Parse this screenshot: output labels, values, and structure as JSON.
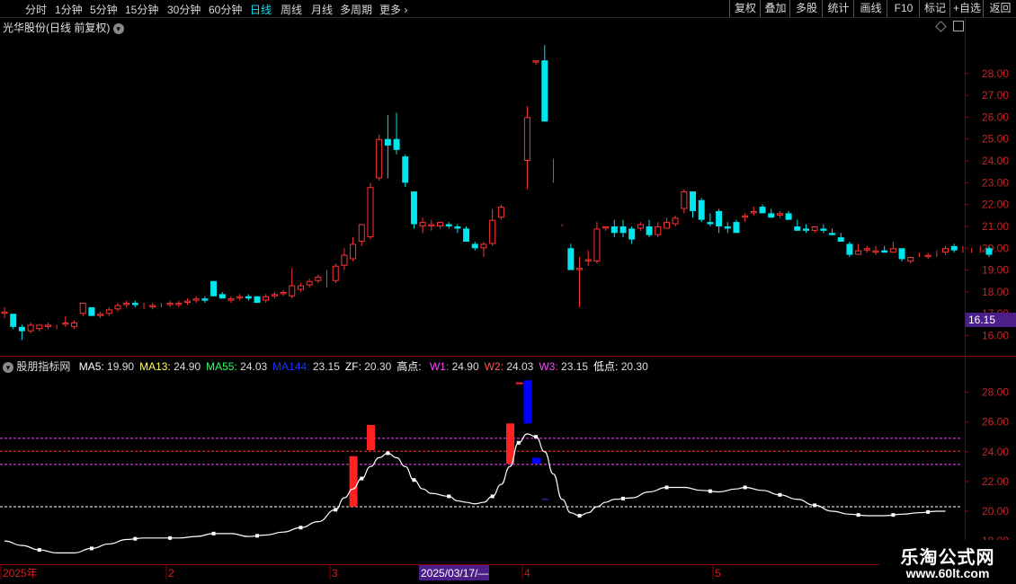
{
  "toolbar": {
    "periods": [
      "分时",
      "1分钟",
      "5分钟",
      "15分钟",
      "30分钟",
      "60分钟",
      "日线",
      "周线",
      "月线",
      "多周期",
      "更多"
    ],
    "active_period": "日线",
    "more_arrow": "›",
    "right_buttons": [
      "复权",
      "叠加",
      "多股",
      "统计",
      "画线",
      "F10",
      "标记",
      "+自选",
      "返回"
    ]
  },
  "stock": {
    "title": "光华股份(日线 前复权)",
    "dropdown_icon": "chevron-down-icon",
    "diamond_icon": "diamond-icon",
    "panel_icon": "window-icon"
  },
  "main_axis": {
    "ticks": [
      "28.00",
      "27.00",
      "26.00",
      "25.00",
      "24.00",
      "23.00",
      "22.00",
      "21.00",
      "20.00",
      "19.00",
      "18.00",
      "17.00",
      "16.00"
    ],
    "price_tag": "16.15",
    "ymin": 15.2,
    "ymax": 29.8
  },
  "indicator": {
    "name": "股朋指标网",
    "items": [
      {
        "label": "MA5: ",
        "value": "19.90",
        "color": "#ffffff"
      },
      {
        "label": "MA13: ",
        "value": "24.90",
        "color": "#ffff55"
      },
      {
        "label": "MA55: ",
        "value": "24.03",
        "color": "#33ff66"
      },
      {
        "label": "MA144: ",
        "value": "23.15",
        "color": "#2233ff"
      },
      {
        "label": "ZF: ",
        "value": "20.30",
        "color": "#ffffff"
      },
      {
        "label": "高点: ",
        "value": "",
        "color": "#ffffff"
      },
      {
        "label": "W1: ",
        "value": "24.90",
        "color": "#ff44ff"
      },
      {
        "label": "W2: ",
        "value": "24.03",
        "color": "#ff5555"
      },
      {
        "label": "W3: ",
        "value": "23.15",
        "color": "#ff44ff"
      },
      {
        "label": "低点: ",
        "value": "20.30",
        "color": "#ffffff"
      }
    ],
    "ticks": [
      "28.00",
      "26.00",
      "24.00",
      "22.00",
      "20.00",
      "18.00"
    ],
    "ymin": 16.8,
    "ymax": 29.3,
    "levels": [
      {
        "value": 24.9,
        "color": "#ff44ff"
      },
      {
        "value": 24.03,
        "color": "#ff3333"
      },
      {
        "value": 23.15,
        "color": "#ff44ff"
      },
      {
        "value": 20.3,
        "color": "#ffffff"
      }
    ]
  },
  "x_axis": {
    "labels": [
      "2025年",
      "2",
      "3",
      "2025/03/17/—",
      "4",
      "5"
    ],
    "highlight": "2025/03/17/—"
  },
  "watermark": {
    "line1": "乐淘公式网",
    "line2": "www.60lt.com"
  },
  "colors": {
    "up": "#ff3333",
    "down": "#00e5ee",
    "axis": "#8b0000",
    "grid": "#5a0000"
  },
  "chart_data": {
    "type": "candlestick",
    "candles": [
      [
        17.0,
        17.3,
        16.8,
        17.1
      ],
      [
        17.0,
        17.0,
        16.3,
        16.4
      ],
      [
        16.4,
        16.5,
        15.8,
        16.2
      ],
      [
        16.2,
        16.6,
        16.1,
        16.5
      ],
      [
        16.3,
        16.5,
        16.2,
        16.5
      ],
      [
        16.4,
        16.6,
        16.3,
        16.5
      ],
      [
        16.4,
        16.5,
        16.3,
        16.4
      ],
      [
        16.5,
        16.9,
        16.4,
        16.6
      ],
      [
        16.4,
        16.7,
        16.3,
        16.6
      ],
      [
        17.0,
        17.4,
        16.9,
        17.5
      ],
      [
        17.3,
        17.3,
        16.9,
        16.9
      ],
      [
        16.9,
        17.1,
        16.8,
        17.0
      ],
      [
        17.0,
        17.3,
        16.9,
        17.2
      ],
      [
        17.2,
        17.5,
        17.1,
        17.4
      ],
      [
        17.4,
        17.6,
        17.3,
        17.5
      ],
      [
        17.5,
        17.6,
        17.3,
        17.4
      ],
      [
        17.3,
        17.5,
        17.2,
        17.3
      ],
      [
        17.3,
        17.5,
        17.2,
        17.4
      ],
      [
        17.4,
        17.5,
        17.3,
        17.4
      ],
      [
        17.4,
        17.6,
        17.3,
        17.5
      ],
      [
        17.4,
        17.6,
        17.3,
        17.5
      ],
      [
        17.5,
        17.7,
        17.4,
        17.6
      ],
      [
        17.6,
        17.8,
        17.5,
        17.7
      ],
      [
        17.7,
        17.8,
        17.5,
        17.6
      ],
      [
        18.5,
        18.5,
        17.8,
        17.8
      ],
      [
        17.9,
        18.0,
        17.7,
        17.7
      ],
      [
        17.6,
        17.8,
        17.5,
        17.7
      ],
      [
        17.7,
        17.9,
        17.6,
        17.8
      ],
      [
        17.8,
        17.9,
        17.6,
        17.7
      ],
      [
        17.8,
        17.8,
        17.5,
        17.5
      ],
      [
        17.6,
        17.9,
        17.5,
        17.8
      ],
      [
        17.8,
        18.0,
        17.7,
        17.9
      ],
      [
        17.9,
        18.1,
        17.8,
        18.0
      ],
      [
        17.8,
        19.1,
        17.7,
        18.3
      ],
      [
        18.1,
        18.4,
        18.0,
        18.3
      ],
      [
        18.3,
        18.6,
        18.2,
        18.5
      ],
      [
        18.5,
        18.8,
        18.4,
        18.7
      ],
      [
        18.7,
        19.0,
        18.2,
        18.7
      ],
      [
        18.5,
        19.3,
        18.4,
        19.2
      ],
      [
        19.2,
        20.0,
        19.0,
        19.7
      ],
      [
        19.5,
        20.5,
        19.4,
        20.2
      ],
      [
        20.3,
        21.1,
        20.1,
        21.1
      ],
      [
        20.5,
        23.0,
        20.4,
        22.8
      ],
      [
        23.2,
        25.2,
        23.1,
        25.0
      ],
      [
        25.0,
        26.1,
        23.2,
        24.7
      ],
      [
        25.0,
        26.2,
        24.3,
        24.5
      ],
      [
        24.2,
        24.3,
        22.8,
        23.0
      ],
      [
        22.6,
        22.6,
        20.9,
        21.1
      ],
      [
        21.0,
        21.4,
        20.7,
        21.2
      ],
      [
        21.0,
        21.3,
        20.8,
        21.1
      ],
      [
        21.0,
        21.2,
        20.9,
        21.2
      ],
      [
        21.1,
        21.2,
        20.9,
        21.0
      ],
      [
        21.0,
        21.1,
        20.7,
        20.9
      ],
      [
        20.9,
        21.0,
        20.5,
        20.3
      ],
      [
        20.2,
        20.3,
        19.9,
        20.0
      ],
      [
        20.0,
        20.3,
        19.6,
        20.2
      ],
      [
        20.2,
        21.8,
        20.1,
        21.3
      ],
      [
        21.4,
        22.0,
        21.3,
        21.9
      ],
      [
        21.6,
        21.6,
        21.6,
        21.6
      ],
      [
        23.6,
        23.6,
        23.6,
        23.6
      ],
      [
        24.0,
        26.5,
        22.7,
        26.0
      ],
      [
        28.5,
        28.6,
        28.4,
        28.6
      ],
      [
        28.6,
        29.3,
        25.8,
        25.8
      ],
      [
        23.5,
        24.1,
        23.0,
        23.5
      ],
      [
        21.0,
        21.1,
        21.0,
        21.0
      ],
      [
        20.0,
        20.2,
        19.1,
        19.0
      ],
      [
        19.0,
        19.6,
        17.3,
        19.1
      ],
      [
        19.4,
        19.9,
        19.2,
        19.5
      ],
      [
        19.4,
        21.2,
        19.3,
        20.9
      ],
      [
        20.9,
        21.0,
        20.8,
        21.0
      ],
      [
        21.0,
        21.3,
        20.5,
        20.7
      ],
      [
        21.0,
        21.3,
        20.5,
        20.7
      ],
      [
        20.9,
        21.0,
        20.2,
        20.4
      ],
      [
        20.9,
        21.2,
        20.8,
        21.1
      ],
      [
        21.0,
        21.3,
        20.5,
        20.6
      ],
      [
        20.6,
        21.2,
        20.5,
        21.0
      ],
      [
        20.9,
        21.4,
        20.9,
        21.2
      ],
      [
        21.1,
        21.5,
        21.0,
        21.4
      ],
      [
        21.8,
        22.7,
        21.6,
        22.6
      ],
      [
        22.6,
        22.6,
        21.4,
        21.7
      ],
      [
        22.2,
        22.3,
        21.2,
        21.3
      ],
      [
        21.2,
        21.6,
        21.0,
        21.1
      ],
      [
        21.7,
        21.8,
        20.7,
        21.0
      ],
      [
        21.0,
        21.2,
        20.7,
        20.9
      ],
      [
        21.2,
        21.3,
        20.8,
        20.7
      ],
      [
        21.4,
        21.6,
        21.2,
        21.5
      ],
      [
        21.6,
        21.9,
        21.5,
        21.7
      ],
      [
        21.9,
        22.0,
        21.6,
        21.6
      ],
      [
        21.6,
        21.8,
        21.4,
        21.4
      ],
      [
        21.5,
        21.7,
        21.4,
        21.6
      ],
      [
        21.6,
        21.7,
        21.3,
        21.3
      ],
      [
        21.0,
        21.3,
        20.8,
        20.8
      ],
      [
        20.9,
        21.1,
        20.7,
        20.8
      ],
      [
        20.8,
        21.0,
        20.7,
        21.0
      ],
      [
        20.9,
        21.1,
        20.7,
        20.8
      ],
      [
        20.7,
        20.9,
        20.6,
        20.6
      ],
      [
        20.5,
        20.7,
        20.3,
        20.3
      ],
      [
        20.2,
        20.3,
        19.6,
        19.7
      ],
      [
        19.7,
        20.2,
        19.7,
        19.9
      ],
      [
        19.9,
        20.1,
        19.8,
        20.0
      ],
      [
        19.8,
        20.1,
        19.7,
        19.9
      ],
      [
        19.9,
        20.1,
        19.8,
        19.8
      ],
      [
        19.8,
        20.3,
        19.8,
        20.0
      ],
      [
        20.0,
        20.0,
        19.4,
        19.5
      ],
      [
        19.4,
        19.6,
        19.3,
        19.6
      ],
      [
        19.7,
        19.8,
        19.6,
        19.7
      ],
      [
        19.6,
        19.8,
        19.5,
        19.7
      ],
      [
        19.8,
        19.9,
        19.6,
        19.8
      ],
      [
        19.8,
        20.1,
        19.7,
        20.0
      ],
      [
        20.1,
        20.2,
        19.8,
        19.9
      ],
      [
        19.9,
        20.1,
        19.8,
        19.9
      ],
      [
        19.9,
        20.0,
        19.8,
        19.9
      ],
      [
        19.9,
        20.1,
        19.8,
        19.9
      ],
      [
        20.0,
        20.1,
        19.6,
        19.7
      ]
    ],
    "line_curve": [
      [
        0,
        18.0
      ],
      [
        2,
        17.7
      ],
      [
        4,
        17.4
      ],
      [
        6,
        17.2
      ],
      [
        8,
        17.2
      ],
      [
        10,
        17.5
      ],
      [
        12,
        17.8
      ],
      [
        14,
        18.1
      ],
      [
        16,
        18.2
      ],
      [
        18,
        18.2
      ],
      [
        20,
        18.2
      ],
      [
        22,
        18.3
      ],
      [
        24,
        18.5
      ],
      [
        26,
        18.5
      ],
      [
        28,
        18.3
      ],
      [
        30,
        18.4
      ],
      [
        32,
        18.6
      ],
      [
        34,
        18.9
      ],
      [
        36,
        19.3
      ],
      [
        38,
        20.1
      ],
      [
        39,
        20.9
      ],
      [
        40,
        21.5
      ],
      [
        41,
        22.2
      ],
      [
        42,
        23.0
      ],
      [
        43,
        23.6
      ],
      [
        44,
        23.9
      ],
      [
        45,
        23.6
      ],
      [
        46,
        23.0
      ],
      [
        47,
        22.1
      ],
      [
        48,
        21.5
      ],
      [
        49,
        21.2
      ],
      [
        51,
        21.0
      ],
      [
        52,
        20.7
      ],
      [
        53,
        20.6
      ],
      [
        54,
        20.5
      ],
      [
        55,
        20.6
      ],
      [
        56,
        21.0
      ],
      [
        57,
        21.8
      ],
      [
        58,
        23.0
      ],
      [
        59,
        24.6
      ],
      [
        60,
        25.2
      ],
      [
        61,
        25.0
      ],
      [
        62,
        24.0
      ],
      [
        63,
        22.5
      ],
      [
        64,
        20.8
      ],
      [
        65,
        19.9
      ],
      [
        66,
        19.7
      ],
      [
        67,
        19.9
      ],
      [
        68,
        20.3
      ],
      [
        69,
        20.6
      ],
      [
        70,
        20.8
      ],
      [
        72,
        20.9
      ],
      [
        74,
        21.3
      ],
      [
        76,
        21.6
      ],
      [
        78,
        21.6
      ],
      [
        80,
        21.4
      ],
      [
        82,
        21.3
      ],
      [
        84,
        21.5
      ],
      [
        85,
        21.6
      ],
      [
        87,
        21.4
      ],
      [
        89,
        21.1
      ],
      [
        91,
        20.8
      ],
      [
        93,
        20.4
      ],
      [
        95,
        20.0
      ],
      [
        97,
        19.8
      ],
      [
        99,
        19.7
      ],
      [
        101,
        19.7
      ],
      [
        103,
        19.8
      ],
      [
        105,
        19.9
      ],
      [
        107,
        20.0
      ],
      [
        108,
        20.0
      ]
    ],
    "line_markers": [
      4,
      10,
      15,
      19,
      24,
      29,
      34,
      38,
      41,
      44,
      47,
      51,
      56,
      59,
      61,
      66,
      71,
      76,
      81,
      85,
      89,
      93,
      98,
      102,
      106
    ],
    "bars": [
      {
        "i": 40,
        "lo": 20.3,
        "hi": 23.7,
        "color": "#ff2222"
      },
      {
        "i": 42,
        "lo": 24.1,
        "hi": 25.8,
        "color": "#ff2222"
      },
      {
        "i": 58,
        "lo": 23.2,
        "hi": 25.9,
        "color": "#ff2222"
      },
      {
        "i": 60,
        "lo": 25.9,
        "hi": 28.8,
        "color": "#0000ff"
      },
      {
        "i": 61,
        "lo": 23.2,
        "hi": 23.6,
        "color": "#0000ff"
      }
    ]
  }
}
